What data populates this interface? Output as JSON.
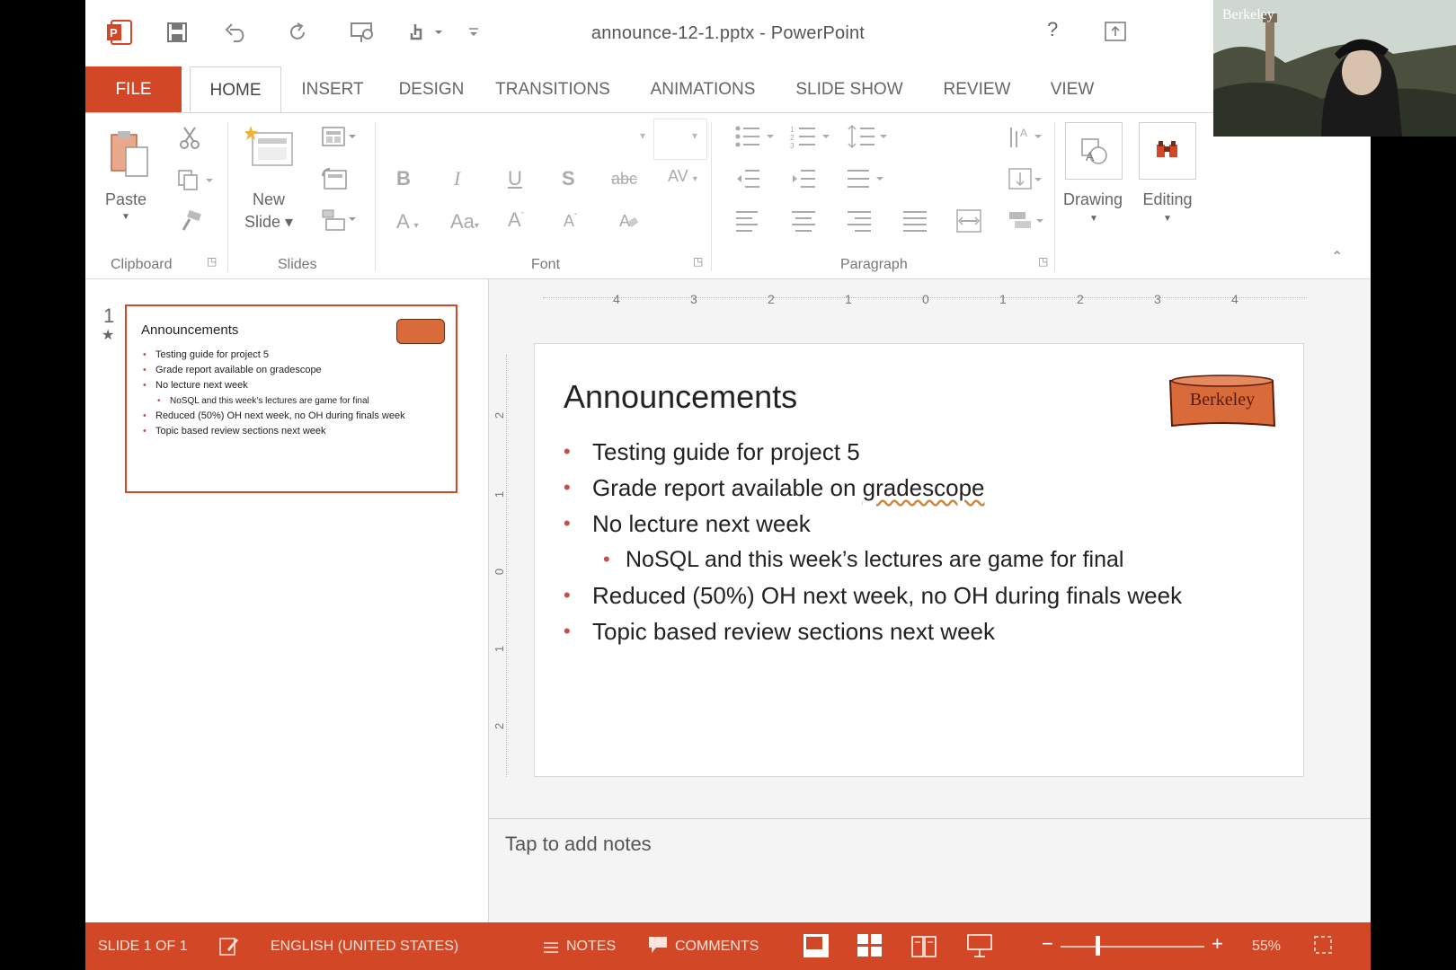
{
  "window": {
    "title": "announce-12-1.pptx - PowerPoint",
    "help": "?",
    "restore": "⇧"
  },
  "quick_access": {
    "app_icon": "powerpoint-icon",
    "save": "save-icon",
    "undo": "undo-icon",
    "redo": "repeat-icon",
    "present": "present-icon",
    "touch": "touch-mode-icon",
    "customize": "customize-qat-icon"
  },
  "tabs": [
    {
      "label": "FILE"
    },
    {
      "label": "HOME"
    },
    {
      "label": "INSERT"
    },
    {
      "label": "DESIGN"
    },
    {
      "label": "TRANSITIONS"
    },
    {
      "label": "ANIMATIONS"
    },
    {
      "label": "SLIDE SHOW"
    },
    {
      "label": "REVIEW"
    },
    {
      "label": "VIEW"
    }
  ],
  "ribbon": {
    "paste_label": "Paste",
    "new_slide_label_1": "New",
    "new_slide_label_2": "Slide",
    "drawing_label": "Drawing",
    "editing_label": "Editing",
    "groups": {
      "clipboard": "Clipboard",
      "slides": "Slides",
      "font": "Font",
      "paragraph": "Paragraph"
    },
    "font_buttons": {
      "bold": "B",
      "italic": "I",
      "underline": "U",
      "shadow": "S",
      "strike": "abc",
      "spacing": "AV",
      "color": "A",
      "case": "Aa",
      "grow": "A",
      "shrink": "A"
    }
  },
  "ruler": {
    "h_ticks": [
      "4",
      "3",
      "2",
      "1",
      "0",
      "1",
      "2",
      "3",
      "4"
    ],
    "v_ticks": [
      "2",
      "1",
      "0",
      "1",
      "2"
    ]
  },
  "thumbnail": {
    "number": "1",
    "star": "★"
  },
  "slide": {
    "title": "Announcements",
    "bullets": [
      {
        "text": "Testing guide for project 5",
        "level": 1
      },
      {
        "text": "Grade report available on ",
        "link": "gradescope",
        "level": 1
      },
      {
        "text": "No lecture next week",
        "level": 1
      },
      {
        "text": "NoSQL and this week’s lectures are game for final",
        "level": 2
      },
      {
        "text": "Reduced (50%) OH next week, no OH during finals week",
        "level": 1
      },
      {
        "text": "Topic based review sections next week",
        "level": 1
      }
    ],
    "logo_text": "Berkeley",
    "accent_color": "#d96b3a"
  },
  "notes_placeholder": "Tap to add notes",
  "status_bar": {
    "slide_info": "SLIDE 1 OF 1",
    "language": "ENGLISH (UNITED STATES)",
    "notes": "NOTES",
    "comments": "COMMENTS",
    "zoom": "55%",
    "zoom_minus": "−",
    "zoom_plus": "+",
    "color": "#d24726"
  },
  "webcam": {
    "label": "Berkeley"
  }
}
